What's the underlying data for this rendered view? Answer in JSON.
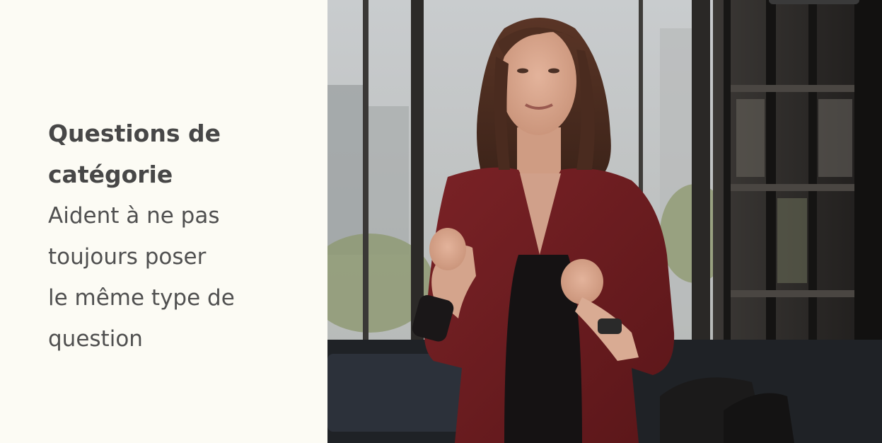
{
  "caption": {
    "title_line1": "Questions de",
    "title_line2": "catégorie",
    "body_lines": [
      "Aident à ne pas",
      "toujours poser",
      "le même type de",
      "question"
    ]
  },
  "colors": {
    "panel_background": "#fcfbf4",
    "caption_text": "#4a4a4a",
    "jacket": "#6b1c1f"
  },
  "video": {
    "subject": "speaker-presenting"
  }
}
